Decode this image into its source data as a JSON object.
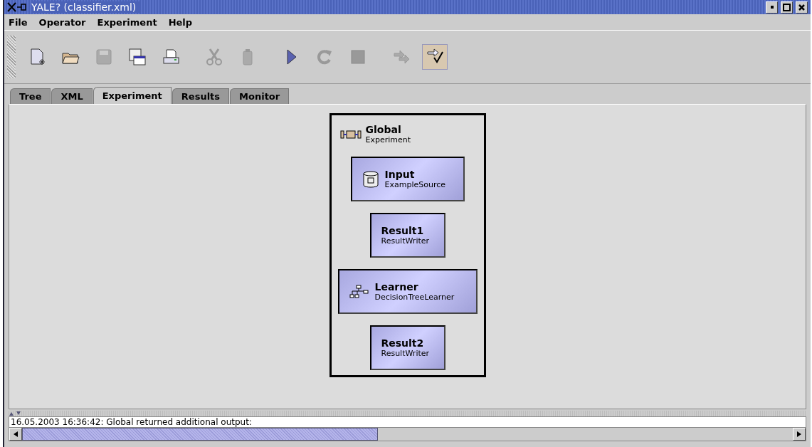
{
  "window": {
    "title": "YALE? (classifier.xml)"
  },
  "menu": [
    {
      "label": "File"
    },
    {
      "label": "Operator"
    },
    {
      "label": "Experiment"
    },
    {
      "label": "Help"
    }
  ],
  "toolbar": [
    {
      "kind": "new",
      "disabled": false,
      "selected": false
    },
    {
      "kind": "open",
      "disabled": false,
      "selected": false
    },
    {
      "kind": "save",
      "disabled": true,
      "selected": false
    },
    {
      "kind": "saveas",
      "disabled": false,
      "selected": false
    },
    {
      "kind": "print",
      "disabled": false,
      "selected": false
    },
    {
      "kind": "cut",
      "disabled": true,
      "selected": false
    },
    {
      "kind": "paste",
      "disabled": true,
      "selected": false
    },
    {
      "kind": "run",
      "disabled": false,
      "selected": false
    },
    {
      "kind": "resume",
      "disabled": true,
      "selected": false
    },
    {
      "kind": "stop",
      "disabled": true,
      "selected": false
    },
    {
      "kind": "wizard",
      "disabled": true,
      "selected": false
    },
    {
      "kind": "validate",
      "disabled": false,
      "selected": true
    }
  ],
  "tabs": [
    {
      "label": "Tree",
      "selected": false
    },
    {
      "label": "XML",
      "selected": false
    },
    {
      "label": "Experiment",
      "selected": true
    },
    {
      "label": "Results",
      "selected": false
    },
    {
      "label": "Monitor",
      "selected": false
    }
  ],
  "experiment": {
    "name": "Global",
    "type": "Experiment",
    "operators": [
      {
        "name": "Input",
        "type": "ExampleSource",
        "kind": "source"
      },
      {
        "name": "Result1",
        "type": "ResultWriter",
        "kind": "writer"
      },
      {
        "name": "Learner",
        "type": "DecisionTreeLearner",
        "kind": "learner"
      },
      {
        "name": "Result2",
        "type": "ResultWriter",
        "kind": "writer"
      }
    ]
  },
  "log": {
    "lines": [
      "16.05.2003 16:36:42: Global returned additional output:"
    ]
  }
}
